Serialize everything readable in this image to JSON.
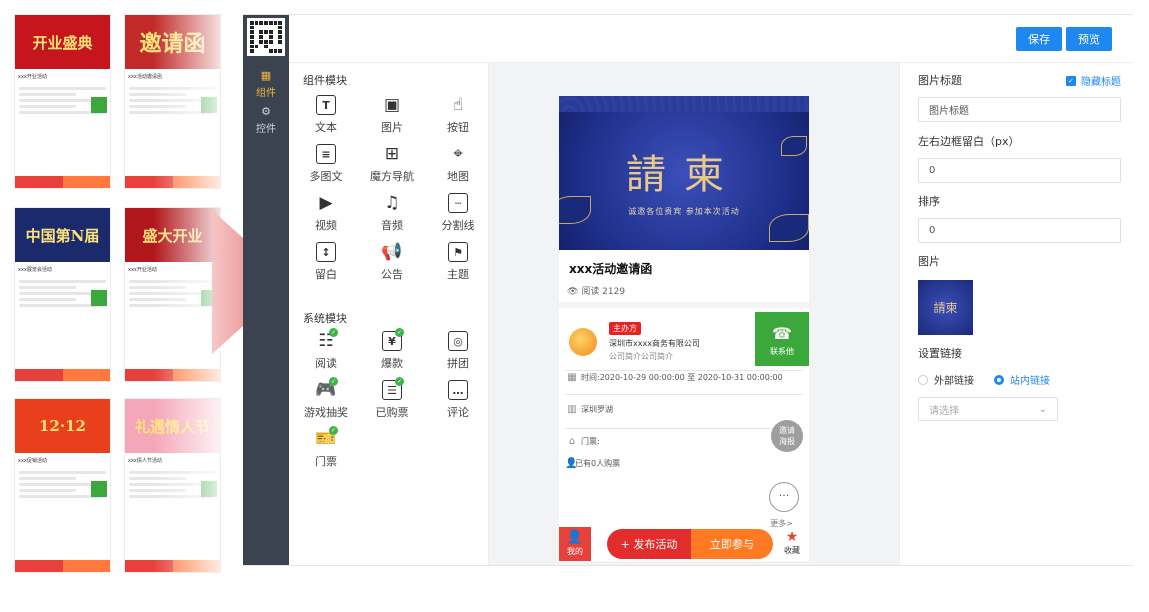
{
  "gallery": {
    "templates": [
      {
        "banner": "开业盛典",
        "name": "xxx开业活动",
        "bg": "#c4161c"
      },
      {
        "banner": "邀请函",
        "name": "xxx活动邀请函",
        "bg": "#c22a2a"
      },
      {
        "banner": "中国第N届",
        "name": "xxx展览会活动",
        "bg": "#1b2a6b"
      },
      {
        "banner": "盛大开业",
        "name": "xxx开业活动",
        "bg": "#b0161c"
      },
      {
        "banner": "12·12",
        "name": "xxx促销活动",
        "bg": "#e8401c"
      },
      {
        "banner": "礼遇情人节",
        "name": "xxx情人节活动",
        "bg": "#f5a6b8"
      }
    ]
  },
  "nav": {
    "items": [
      {
        "label": "组件",
        "icon": "grid-icon",
        "active": true
      },
      {
        "label": "控件",
        "icon": "gear-icon",
        "active": false
      }
    ]
  },
  "toolbar": {
    "save": "保存",
    "preview": "预览"
  },
  "components": {
    "basic_title": "组件模块",
    "basic": [
      {
        "label": "文本",
        "glyph": "T",
        "icon": "text-icon"
      },
      {
        "label": "图片",
        "glyph": "▣",
        "icon": "image-icon"
      },
      {
        "label": "按钮",
        "glyph": "☝",
        "icon": "button-icon"
      },
      {
        "label": "多图文",
        "glyph": "≡",
        "icon": "multi-image-text-icon"
      },
      {
        "label": "魔方导航",
        "glyph": "⊞",
        "icon": "cube-nav-icon"
      },
      {
        "label": "地图",
        "glyph": "⌖",
        "icon": "map-icon"
      },
      {
        "label": "视频",
        "glyph": "▶",
        "icon": "video-icon"
      },
      {
        "label": "音频",
        "glyph": "♫",
        "icon": "audio-icon"
      },
      {
        "label": "分割线",
        "glyph": "┄",
        "icon": "divider-icon"
      },
      {
        "label": "留白",
        "glyph": "↕",
        "icon": "blank-space-icon"
      },
      {
        "label": "公告",
        "glyph": "📢",
        "icon": "notice-icon"
      },
      {
        "label": "主题",
        "glyph": "⚑",
        "icon": "theme-icon"
      }
    ],
    "system_title": "系统模块",
    "system": [
      {
        "label": "阅读",
        "glyph": "☷",
        "icon": "read-icon",
        "checked": true
      },
      {
        "label": "爆款",
        "glyph": "¥",
        "icon": "hot-sale-icon",
        "checked": true
      },
      {
        "label": "拼团",
        "glyph": "◎",
        "icon": "group-buy-icon",
        "checked": false
      },
      {
        "label": "游戏抽奖",
        "glyph": "🎮",
        "icon": "game-lottery-icon",
        "checked": true
      },
      {
        "label": "已购票",
        "glyph": "☰",
        "icon": "purchased-ticket-icon",
        "checked": true
      },
      {
        "label": "评论",
        "glyph": "…",
        "icon": "comment-icon",
        "checked": false
      },
      {
        "label": "门票",
        "glyph": "🎫",
        "icon": "ticket-icon",
        "checked": true
      }
    ]
  },
  "preview": {
    "poster_big": "請柬",
    "poster_sub": "诚邀各位贵宾  参加本次活动",
    "event_title": "xxx活动邀请函",
    "reads": "阅读 2129",
    "organizer_tag": "主办方",
    "organizer_name": "深圳市xxxx商务有限公司",
    "organizer_desc": "公司简介公司简介",
    "contact": "联系他",
    "time": "时间:2020-10-29 00:00:00 至 2020-10-31 00:00:00",
    "location": "深圳罗湖",
    "ticket": "门票:",
    "buyers": "已有0人购票",
    "poster_btn_1": "邀请",
    "poster_btn_2": "海报",
    "more_btn": "···",
    "more": "更多>",
    "mine": "我的",
    "publish": "+ 发布活动",
    "join": "立即参与",
    "collect": "收藏"
  },
  "props": {
    "image_title_label": "图片标题",
    "hide_title": "隐藏标题",
    "image_title_placeholder": "图片标题",
    "padding_label": "左右边框留白（px）",
    "padding_value": "0",
    "order_label": "排序",
    "order_value": "0",
    "image_label": "图片",
    "thumb_text": "請柬",
    "link_label": "设置链接",
    "link_external": "外部链接",
    "link_internal": "站内链接",
    "select_placeholder": "请选择"
  },
  "colors": {
    "accent": "#1e87f0",
    "nav_bg": "#3c4350",
    "red": "#e8403b",
    "green": "#3aa83a",
    "orange": "#ff7a22"
  }
}
